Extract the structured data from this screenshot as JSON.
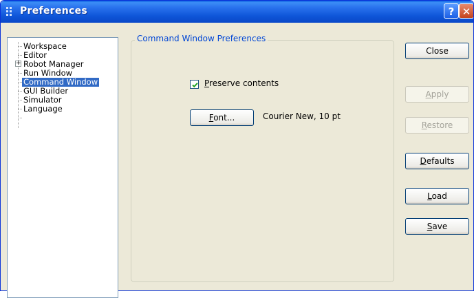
{
  "window": {
    "title": "Preferences"
  },
  "title_buttons": {
    "help": "?",
    "close": "✕"
  },
  "tree": {
    "items": [
      {
        "label": "Workspace",
        "selected": false
      },
      {
        "label": "Editor",
        "selected": false
      },
      {
        "label": "Robot Manager",
        "selected": false,
        "expandable": true
      },
      {
        "label": "Run Window",
        "selected": false
      },
      {
        "label": "Command Window",
        "selected": true
      },
      {
        "label": "GUI Builder",
        "selected": false
      },
      {
        "label": "Simulator",
        "selected": false
      },
      {
        "label": "Language",
        "selected": false
      }
    ],
    "expander_symbol": "+"
  },
  "group": {
    "title": "Command Window Preferences"
  },
  "preserve": {
    "mnemonic": "P",
    "rest": "reserve contents",
    "checked": true
  },
  "font": {
    "mnemonic": "F",
    "rest": "ont...",
    "value": "Courier New, 10 pt"
  },
  "buttons": {
    "close": {
      "label": "Close",
      "enabled": true
    },
    "apply": {
      "mnemonic": "A",
      "rest": "pply",
      "enabled": false
    },
    "restore": {
      "mnemonic": "R",
      "rest": "estore",
      "enabled": false
    },
    "defaults": {
      "mnemonic": "D",
      "rest": "efaults",
      "enabled": true
    },
    "load": {
      "mnemonic": "L",
      "rest": "oad",
      "enabled": true
    },
    "save": {
      "mnemonic": "S",
      "rest": "ave",
      "enabled": true
    }
  },
  "colors": {
    "titlebar": "#0a5fe0",
    "selection": "#316ac5",
    "group_title": "#0046d5",
    "window_bg": "#ece9d8"
  },
  "icons": {
    "app": "preferences-icon",
    "help": "help-icon",
    "close": "close-icon",
    "check": "checkmark-icon",
    "expand": "plus-icon"
  }
}
